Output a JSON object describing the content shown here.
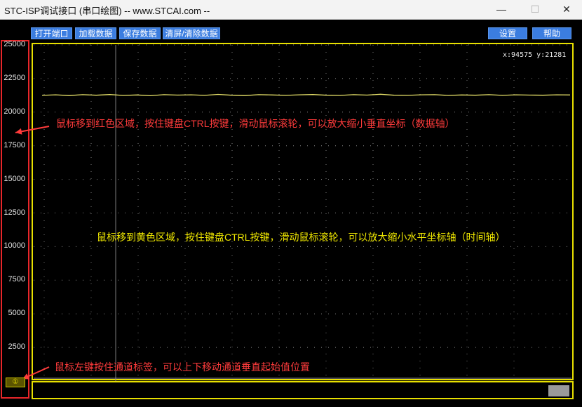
{
  "window": {
    "title": "STC-ISP调试接口 (串口绘图) -- www.STCAI.com --",
    "controls": [
      "—",
      "☐",
      "✕"
    ]
  },
  "toolbar": {
    "open_port": "打开端口",
    "load_data": "加载数据",
    "save_data": "保存数据",
    "clear": "清屏/清除数据",
    "settings": "设置",
    "help": "帮助"
  },
  "readout": "x:94575 y:21281",
  "annotations": {
    "y_zoom": "鼠标移到红色区域，按住键盘CTRL按键，滑动鼠标滚轮，可以放大缩小垂直坐标（数据轴）",
    "x_zoom": "鼠标移到黄色区域，按住键盘CTRL按键，滑动鼠标滚轮，可以放大缩小水平坐标轴（时间轴）",
    "channel_move": "鼠标左键按住通道标签，可以上下移动通道垂直起始值位置"
  },
  "channel_label": "①",
  "colors": {
    "plot_bg": "#000000",
    "signal": "#e8e26a",
    "y_axis_zone": "#e8262a",
    "x_axis_zone": "#e8e000",
    "button": "#3b7de0"
  },
  "chart_data": {
    "type": "line",
    "yticks": [
      "25000",
      "22500",
      "20000",
      "17500",
      "15000",
      "12500",
      "10000",
      "7500",
      "5000",
      "2500"
    ],
    "ylim": [
      0,
      25000
    ],
    "grid": true,
    "series": [
      {
        "values": [
          21250,
          21290,
          21230,
          21300,
          21260,
          21310,
          21240,
          21280,
          21220,
          21300,
          21270,
          21290,
          21250,
          21320,
          21260,
          21230,
          21300,
          21280,
          21250,
          21290,
          21310,
          21260,
          21240,
          21300,
          21270,
          21330,
          21260,
          21250,
          21290,
          21300,
          21240,
          21280,
          21260,
          21300,
          21250,
          21290,
          21270,
          21260,
          21290,
          21280
        ]
      }
    ]
  }
}
